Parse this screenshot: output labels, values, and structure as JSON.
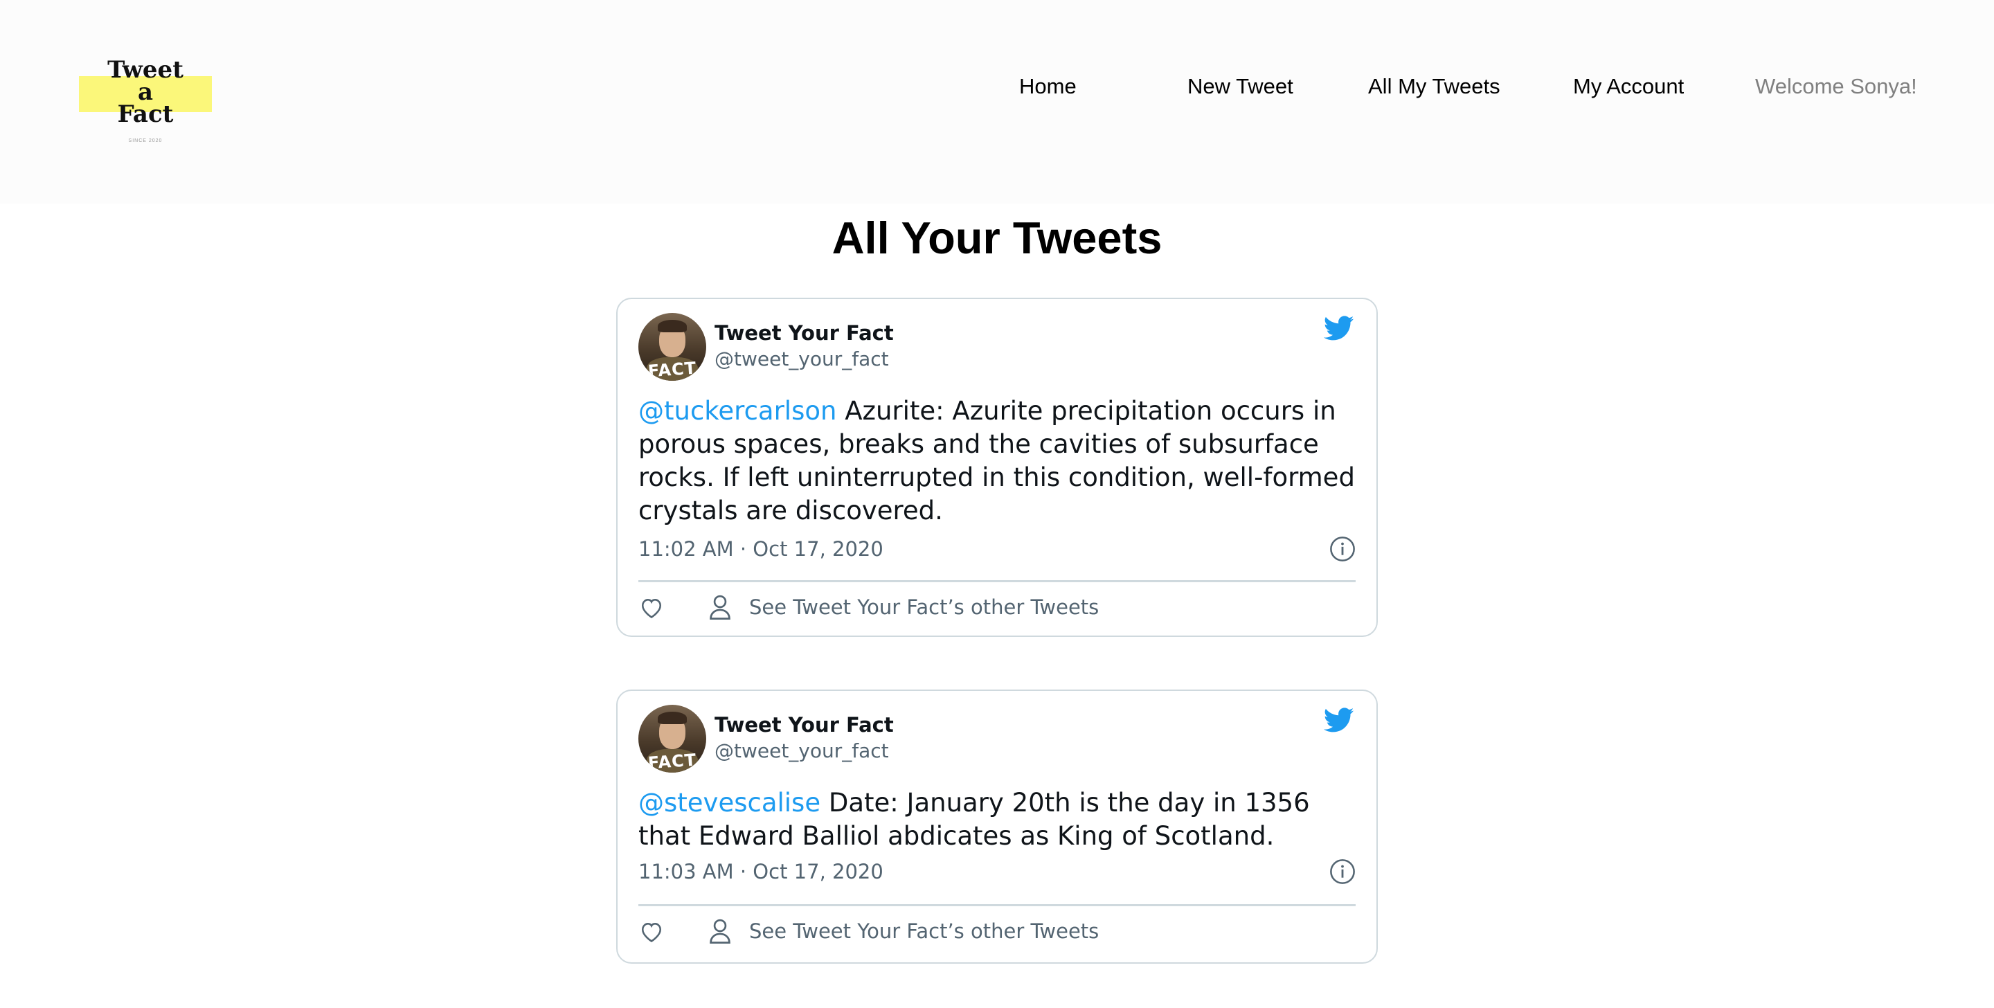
{
  "logo": {
    "line1": "Tweet",
    "line2": "a",
    "line3": "Fact",
    "tagline": "SINCE 2020"
  },
  "nav": {
    "home": "Home",
    "new_tweet": "New Tweet",
    "all_my_tweets": "All My Tweets",
    "my_account": "My Account",
    "welcome": "Welcome Sonya!"
  },
  "page": {
    "title": "All Your Tweets"
  },
  "colors": {
    "accent": "#1d9bf0",
    "logo_highlight": "#fbf77a",
    "muted_text": "#536471"
  },
  "tweets": [
    {
      "avatar_label": "FACT",
      "name": "Tweet Your Fact",
      "handle": "@tweet_your_fact",
      "mention": "@tuckercarlson",
      "text": "Azurite: Azurite precipitation occurs in porous spaces, breaks and the cavities of subsurface rocks. If left uninterrupted in this condition, well-formed crystals are discovered.",
      "timestamp": "11:02 AM · Oct 17, 2020",
      "other_link": "See Tweet Your Fact’s other Tweets"
    },
    {
      "avatar_label": "FACT",
      "name": "Tweet Your Fact",
      "handle": "@tweet_your_fact",
      "mention": "@stevescalise",
      "text": "Date: January 20th is the day in 1356 that Edward Balliol abdicates as King of Scotland.",
      "timestamp": "11:03 AM · Oct 17, 2020",
      "other_link": "See Tweet Your Fact’s other Tweets"
    }
  ]
}
